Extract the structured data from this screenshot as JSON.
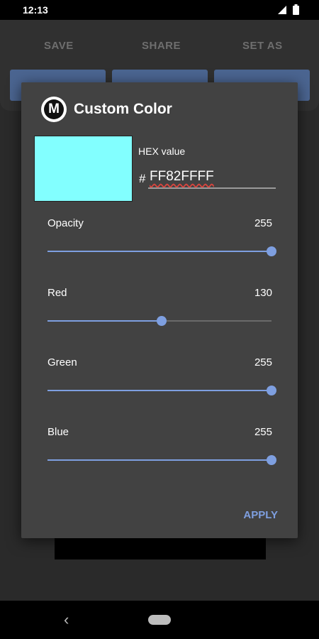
{
  "status_bar": {
    "time": "12:13"
  },
  "toolbar": {
    "save_label": "SAVE",
    "share_label": "SHARE",
    "set_as_label": "SET AS"
  },
  "dialog": {
    "logo_letter": "M",
    "title": "Custom Color",
    "swatch_color": "#82FFFF",
    "hex_label": "HEX value",
    "hex_prefix": "#",
    "hex_value": "FF82FFFF",
    "accent_color": "#7E9FE0",
    "sliders": [
      {
        "label": "Opacity",
        "value": "255",
        "fraction": 1.0
      },
      {
        "label": "Red",
        "value": "130",
        "fraction": 0.51
      },
      {
        "label": "Green",
        "value": "255",
        "fraction": 1.0
      },
      {
        "label": "Blue",
        "value": "255",
        "fraction": 1.0
      }
    ],
    "apply_label": "APPLY"
  }
}
